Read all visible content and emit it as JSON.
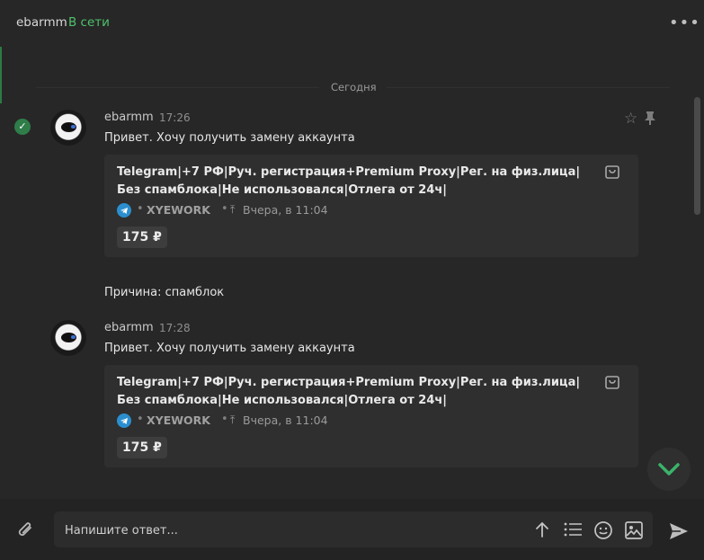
{
  "header": {
    "contact_name": "ebarmm",
    "status": "В сети",
    "more_icon": "more-horizontal-icon"
  },
  "chat": {
    "date_separator": "Сегодня",
    "messages": [
      {
        "author": "ebarmm",
        "time": "17:26",
        "text": "Привет. Хочу получить замену аккаунта",
        "read": true,
        "card": {
          "title": "Telegram|+7 РФ|Руч. регистрация+Premium Proxy|Рег. на физ.лица|Без спамблока|Не использовался|Отлега от 24ч|",
          "platform_icon": "telegram-icon",
          "seller": "XYEWORK",
          "date": "Вчера, в 11:04",
          "price": "175 ₽"
        },
        "followup": "Причина: спамблок"
      },
      {
        "author": "ebarmm",
        "time": "17:28",
        "text": "Привет. Хочу получить замену аккаунта",
        "card": {
          "title": "Telegram|+7 РФ|Руч. регистрация+Premium Proxy|Рег. на физ.лица|Без спамблока|Не использовался|Отлега от 24ч|",
          "platform_icon": "telegram-icon",
          "seller": "XYEWORK",
          "date": "Вчера, в 11:04",
          "price": "175 ₽"
        }
      }
    ]
  },
  "composer": {
    "placeholder": "Напишите ответ..."
  },
  "colors": {
    "background": "#272727",
    "accent_green": "#4ec26b",
    "card_bg": "#2f2f2f",
    "telegram_blue": "#2b8fcf"
  }
}
